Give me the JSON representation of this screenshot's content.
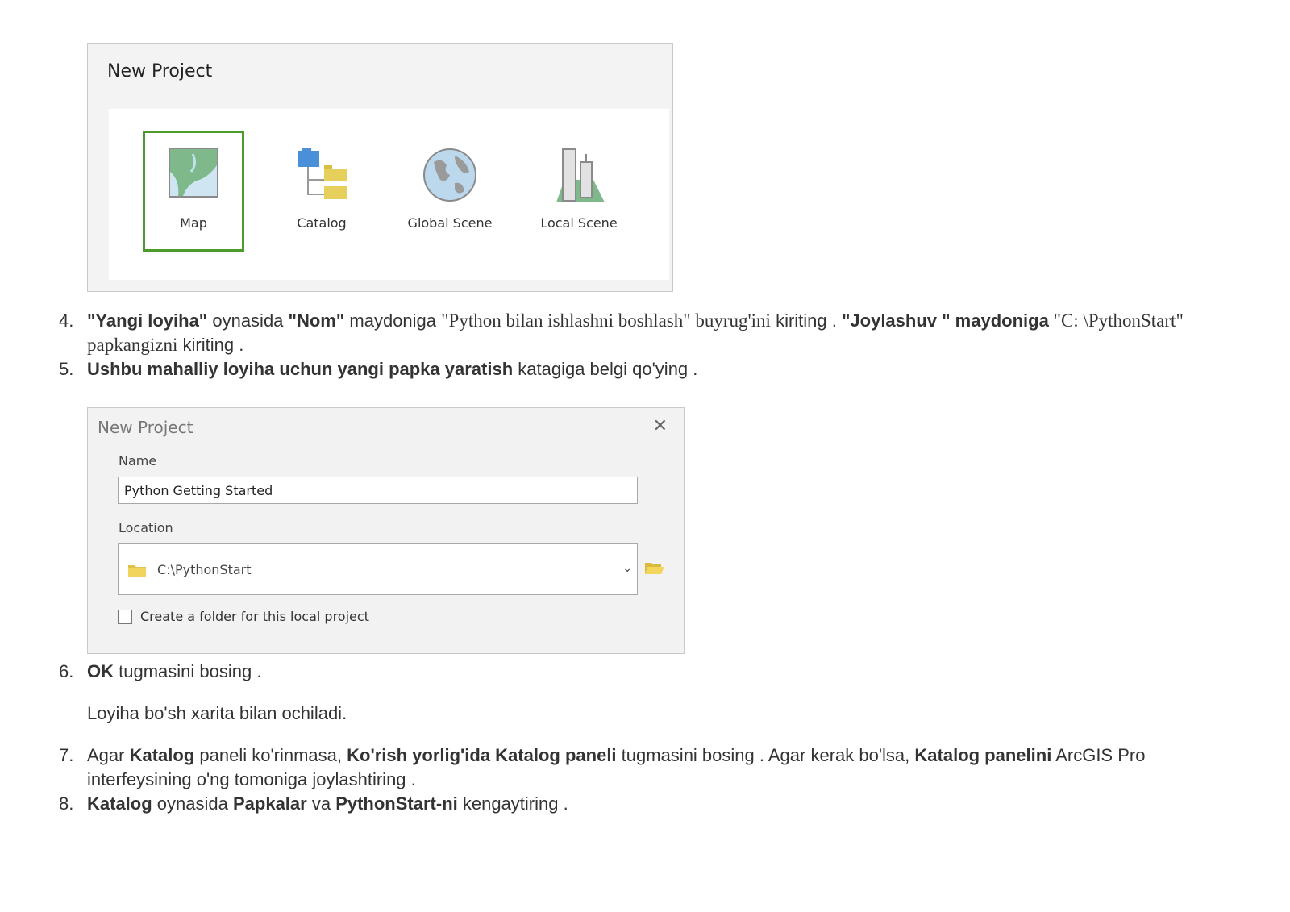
{
  "gallery": {
    "title": "New Project",
    "tiles": [
      {
        "label": "Map",
        "icon": "map-icon",
        "selected": true
      },
      {
        "label": "Catalog",
        "icon": "catalog-icon",
        "selected": false
      },
      {
        "label": "Global Scene",
        "icon": "globe-icon",
        "selected": false
      },
      {
        "label": "Local Scene",
        "icon": "local-scene-icon",
        "selected": false
      }
    ],
    "selected_color": "#4c9a2a"
  },
  "steps_a": [
    {
      "num": "4.",
      "parts": [
        {
          "t": "\"Yangi loyiha\"",
          "b": true
        },
        {
          "t": " oynasida "
        },
        {
          "t": "\"Nom\"",
          "b": true
        },
        {
          "t": " maydoniga ",
          "serif": false
        },
        {
          "t": "\"Python bilan ishlashni boshlash\" buyrug'ini",
          "serif": true
        },
        {
          "t": " kiriting . "
        },
        {
          "t": "\"Joylashuv \" maydoniga",
          "b": true
        },
        {
          "t": " \"C: \\PythonStart\" papkangizni",
          "serif": true
        },
        {
          "t": " kiriting ."
        }
      ]
    },
    {
      "num": "5.",
      "parts": [
        {
          "t": "Ushbu mahalliy loyiha uchun yangi papka yaratish",
          "b": true
        },
        {
          "t": " katagiga belgi qo'ying ."
        }
      ]
    }
  ],
  "dialog": {
    "title": "New Project",
    "close": "✕",
    "name_label": "Name",
    "name_value": "Python Getting Started",
    "location_label": "Location",
    "location_value": "C:\\PythonStart",
    "chevron": "⌄",
    "checkbox_label": "Create a folder for this local project",
    "checkbox_checked": false
  },
  "steps_b": [
    {
      "num": "6.",
      "parts": [
        {
          "t": "OK",
          "b": true
        },
        {
          "t": " tugmasini bosing ."
        }
      ]
    }
  ],
  "note": "Loyiha bo'sh xarita bilan ochiladi.",
  "steps_c": [
    {
      "num": "7.",
      "parts": [
        {
          "t": "Agar "
        },
        {
          "t": "Katalog",
          "b": true
        },
        {
          "t": " paneli ko'rinmasa, "
        },
        {
          "t": "Ko'rish yorlig'ida Katalog paneli",
          "b": true
        },
        {
          "t": " tugmasini bosing . Agar kerak bo'lsa, "
        },
        {
          "t": "Katalog panelini",
          "b": true
        },
        {
          "t": " ArcGIS Pro interfeysining o'ng tomoniga joylashtiring ."
        }
      ]
    },
    {
      "num": "8.",
      "parts": [
        {
          "t": "Katalog",
          "b": true
        },
        {
          "t": " oynasida "
        },
        {
          "t": "Papkalar",
          "b": true
        },
        {
          "t": " va "
        },
        {
          "t": "PythonStart-ni",
          "b": true
        },
        {
          "t": " kengaytiring ."
        }
      ]
    }
  ]
}
